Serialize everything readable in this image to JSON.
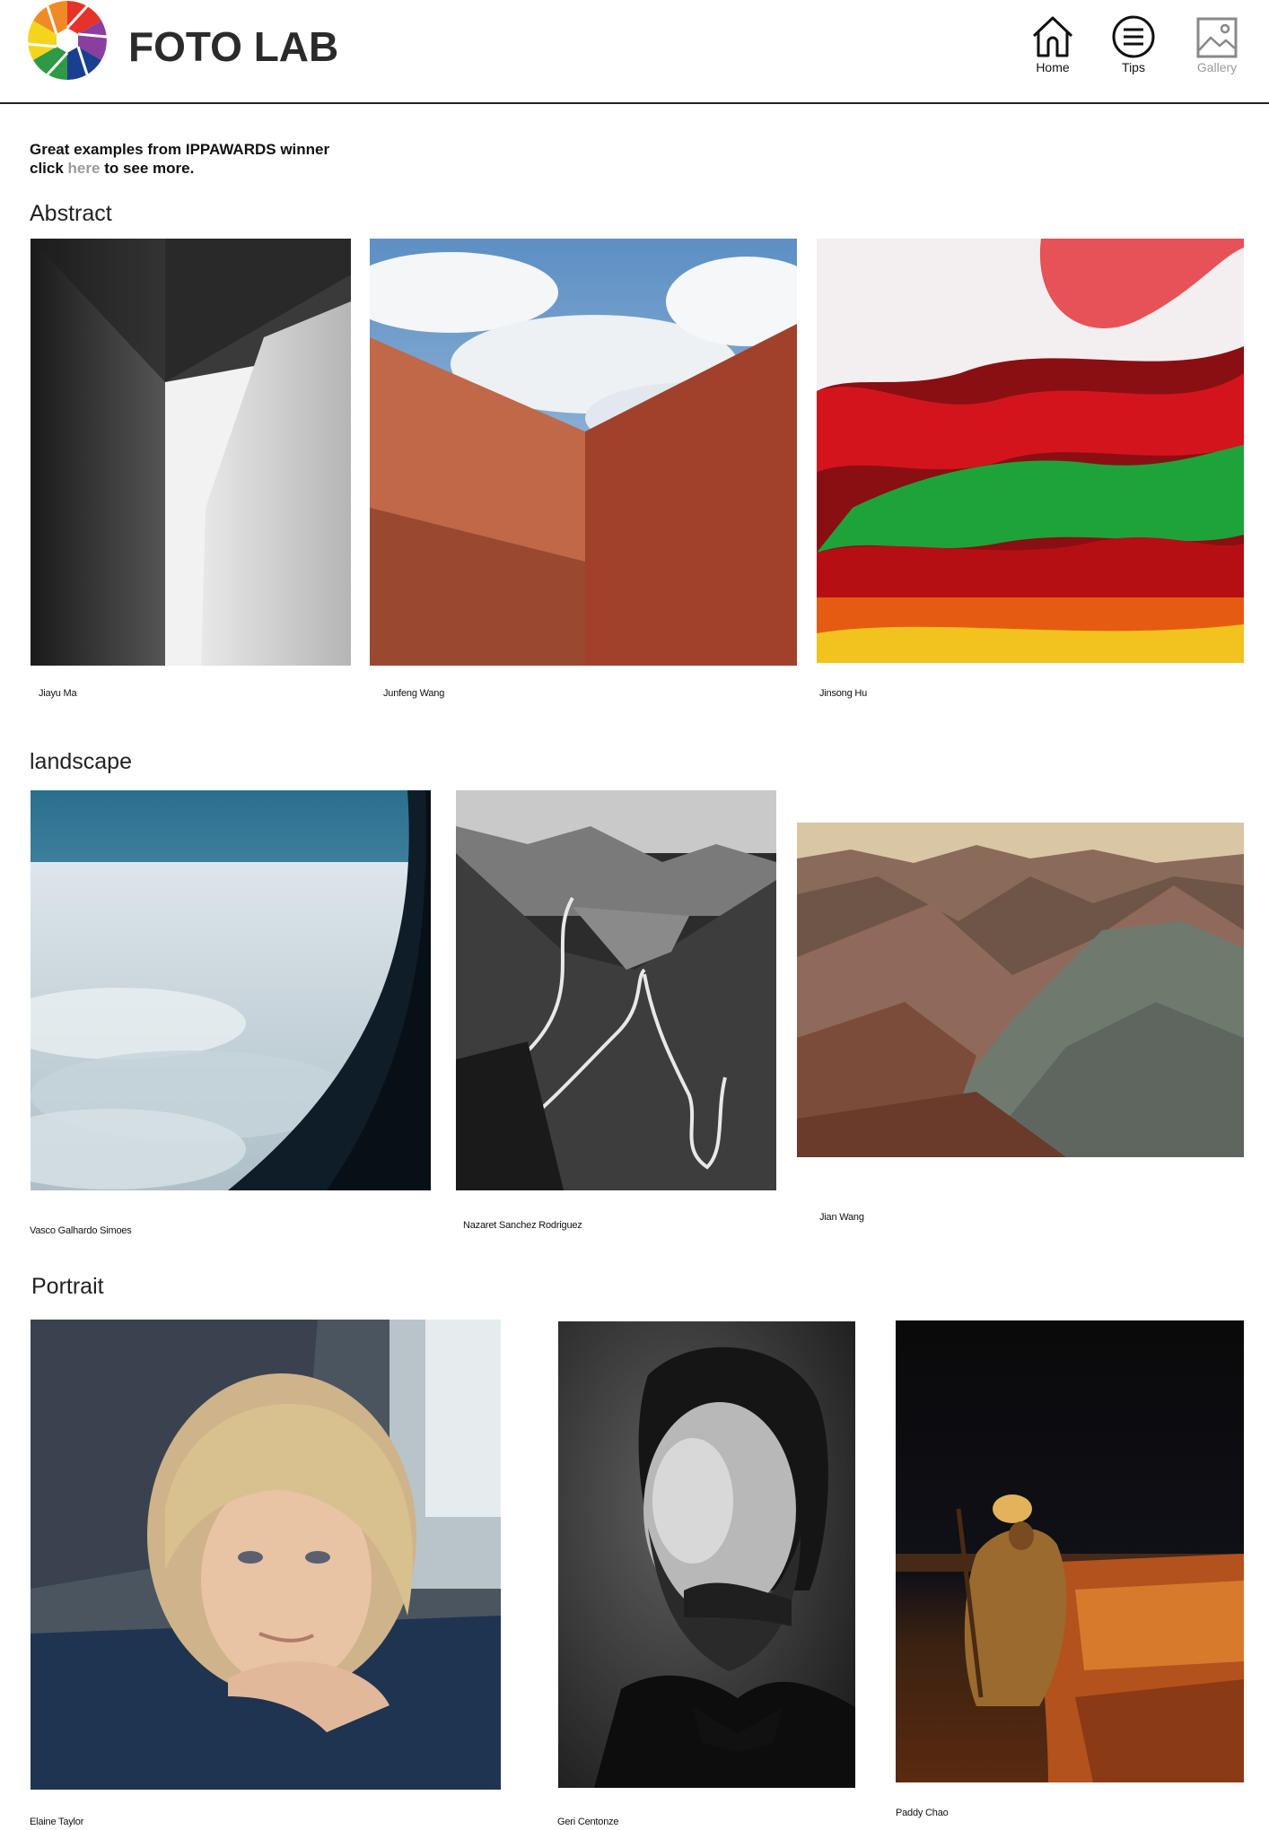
{
  "header": {
    "brand": "FOTO LAB",
    "nav": [
      {
        "label": "Home",
        "icon": "home-icon"
      },
      {
        "label": "Tips",
        "icon": "menu-icon"
      },
      {
        "label": "Gallery",
        "icon": "gallery-icon"
      }
    ]
  },
  "intro": {
    "line1": "Great examples from IPPAWARDS winner",
    "line2_prefix": "click ",
    "link": "here",
    "line2_suffix": " to see more."
  },
  "sections": [
    {
      "title": "Abstract",
      "photos": [
        {
          "caption": "Jiayu Ma"
        },
        {
          "caption": "Junfeng Wang"
        },
        {
          "caption": "Jinsong Hu"
        }
      ]
    },
    {
      "title": "landscape",
      "photos": [
        {
          "caption": "Vasco Galhardo Simoes"
        },
        {
          "caption": "Nazaret Sanchez Rodriguez"
        },
        {
          "caption": "Jian Wang"
        }
      ]
    },
    {
      "title": "Portrait",
      "photos": [
        {
          "caption": "Elaine Taylor"
        },
        {
          "caption": "Geri Centonze"
        },
        {
          "caption": "Paddy Chao"
        }
      ]
    }
  ],
  "colors": {
    "logo": [
      "#e5322b",
      "#8a3ea0",
      "#1b3f8f",
      "#2f9a45",
      "#f4d51d",
      "#f08a24"
    ],
    "divider": "#222222",
    "link": "#9a9a9a"
  }
}
